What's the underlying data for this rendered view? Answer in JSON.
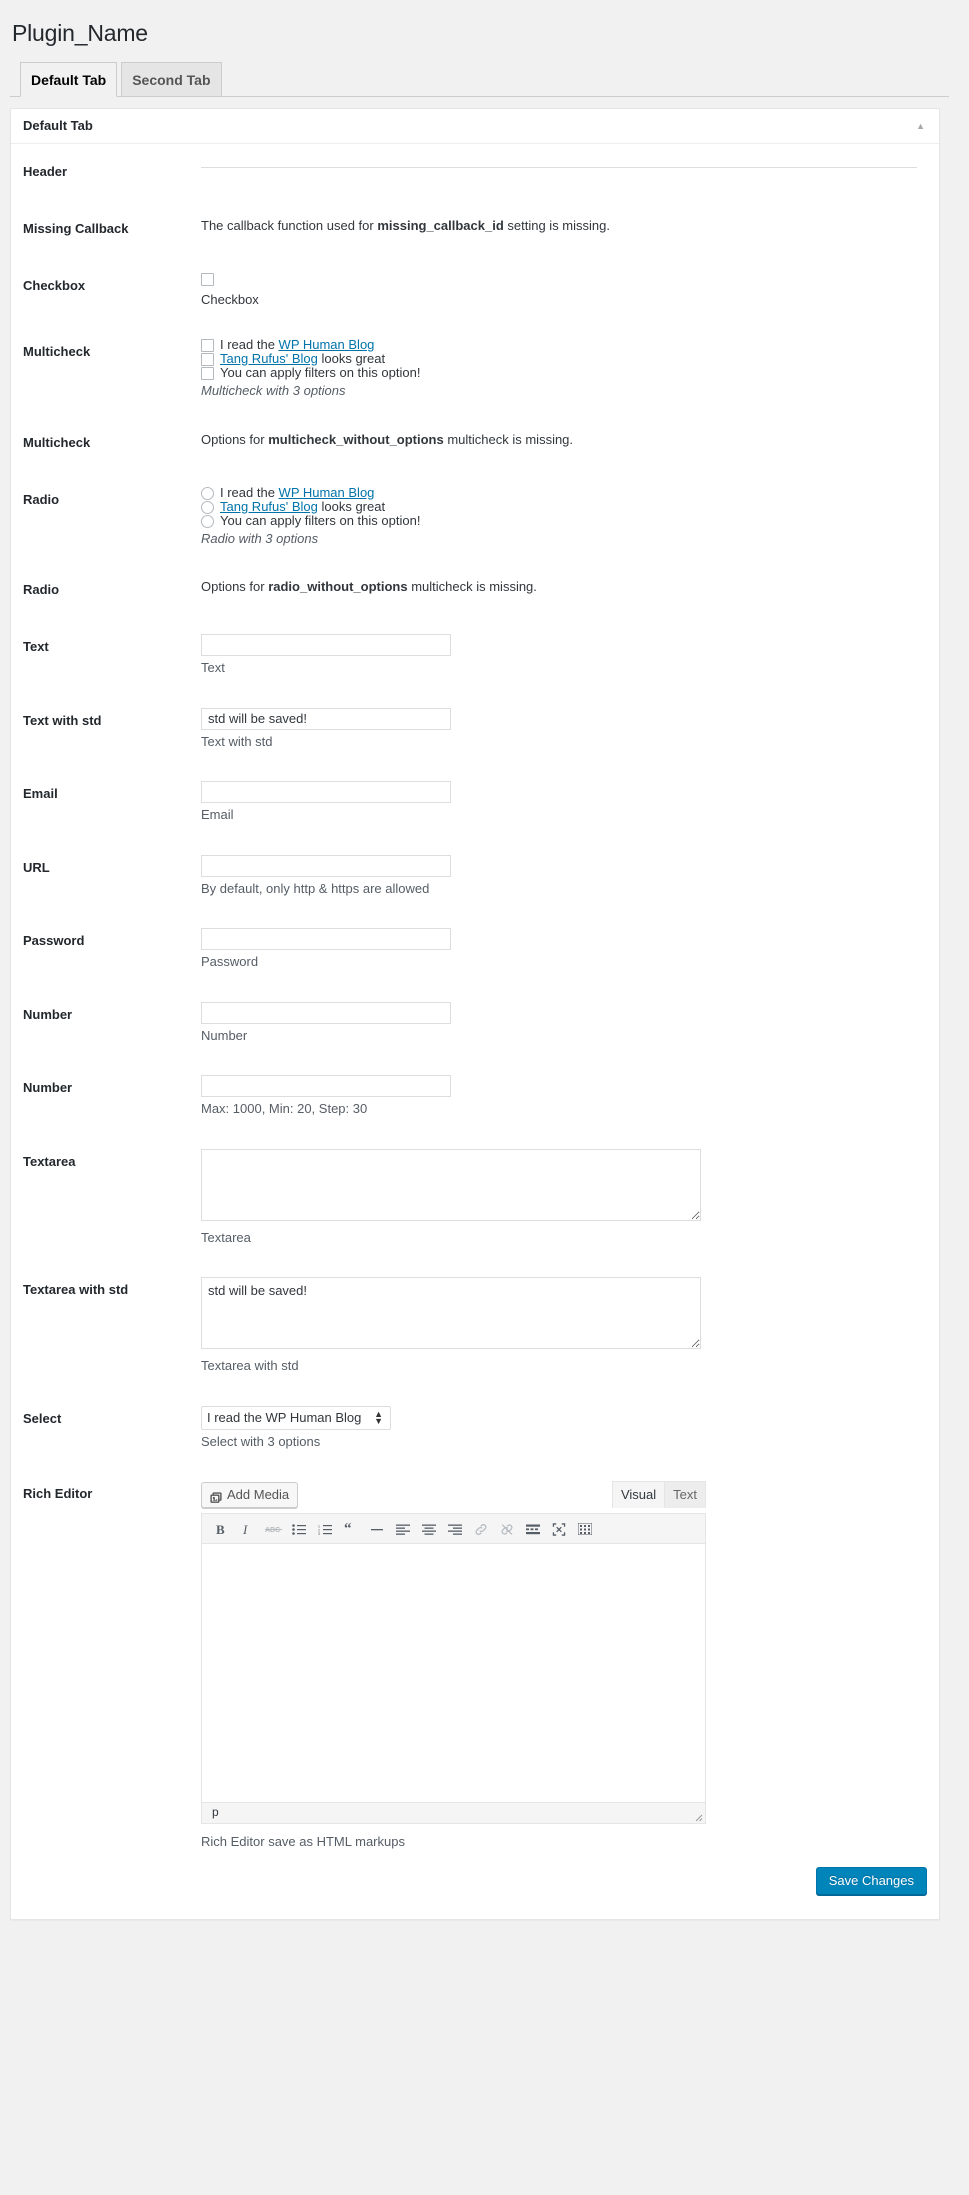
{
  "page": {
    "title": "Plugin_Name"
  },
  "nav_tabs": [
    {
      "label": "Default Tab",
      "active": true
    },
    {
      "label": "Second Tab",
      "active": false
    }
  ],
  "postbox": {
    "title": "Default Tab",
    "toggle_icon": "chevron-up-icon"
  },
  "rows": {
    "header": {
      "label": "Header"
    },
    "missing_callback": {
      "label": "Missing Callback",
      "desc_pre": "The callback function used for ",
      "desc_code": "missing_callback_id",
      "desc_post": " setting is missing."
    },
    "checkbox": {
      "label": "Checkbox",
      "option_label": "Checkbox"
    },
    "multicheck": {
      "label": "Multicheck",
      "options": [
        {
          "pre": "I read the ",
          "link": "WP Human Blog",
          "post": ""
        },
        {
          "pre": "",
          "link": "Tang Rufus' Blog",
          "post": " looks great"
        },
        {
          "pre": "You can apply filters on this option!",
          "link": "",
          "post": ""
        }
      ],
      "desc": "Multicheck with 3 options"
    },
    "multicheck_missing": {
      "label": "Multicheck",
      "desc_pre": "Options for ",
      "desc_code": "multicheck_without_options",
      "desc_post": " multicheck is missing."
    },
    "radio": {
      "label": "Radio",
      "options": [
        {
          "pre": "I read the ",
          "link": "WP Human Blog",
          "post": ""
        },
        {
          "pre": "",
          "link": "Tang Rufus' Blog",
          "post": " looks great"
        },
        {
          "pre": "You can apply filters on this option!",
          "link": "",
          "post": ""
        }
      ],
      "desc": "Radio with 3 options"
    },
    "radio_missing": {
      "label": "Radio",
      "desc_pre": "Options for ",
      "desc_code": "radio_without_options",
      "desc_post": " multicheck is missing."
    },
    "text": {
      "label": "Text",
      "value": "",
      "desc": "Text"
    },
    "text_std": {
      "label": "Text with std",
      "value": "std will be saved!",
      "desc": "Text with std"
    },
    "email": {
      "label": "Email",
      "value": "",
      "desc": "Email"
    },
    "url": {
      "label": "URL",
      "value": "",
      "desc": "By default, only http & https are allowed"
    },
    "password": {
      "label": "Password",
      "value": "",
      "desc": "Password"
    },
    "number": {
      "label": "Number",
      "value": "",
      "desc": "Number"
    },
    "number_limits": {
      "label": "Number",
      "value": "",
      "desc": "Max: 1000, Min: 20, Step: 30"
    },
    "textarea": {
      "label": "Textarea",
      "value": "",
      "desc": "Textarea"
    },
    "textarea_std": {
      "label": "Textarea with std",
      "value": "std will be saved!",
      "desc": "Textarea with std"
    },
    "select": {
      "label": "Select",
      "selected": "I read the WP Human Blog",
      "options": [
        "I read the WP Human Blog",
        "Tang Rufus' Blog looks great",
        "You can apply filters on this option!"
      ],
      "desc": "Select with 3 options"
    },
    "rich_editor": {
      "label": "Rich Editor",
      "add_media_label": "Add Media",
      "tabs": [
        {
          "label": "Visual",
          "active": true
        },
        {
          "label": "Text",
          "active": false
        }
      ],
      "toolbar_buttons": [
        "bold-icon",
        "italic-icon",
        "strikethrough-icon",
        "unordered-list-icon",
        "ordered-list-icon",
        "blockquote-icon",
        "horizontal-rule-icon",
        "align-left-icon",
        "align-center-icon",
        "align-right-icon",
        "insert-link-icon",
        "unlink-icon",
        "read-more-icon",
        "fullscreen-icon",
        "toolbar-toggle-icon"
      ],
      "content": "",
      "statusbar_path": "p",
      "desc": "Rich Editor save as HTML markups"
    }
  },
  "footer": {
    "save_label": "Save Changes"
  },
  "colors": {
    "accent": "#0073aa",
    "primary_button": "#0085ba",
    "link": "#0073aa"
  }
}
